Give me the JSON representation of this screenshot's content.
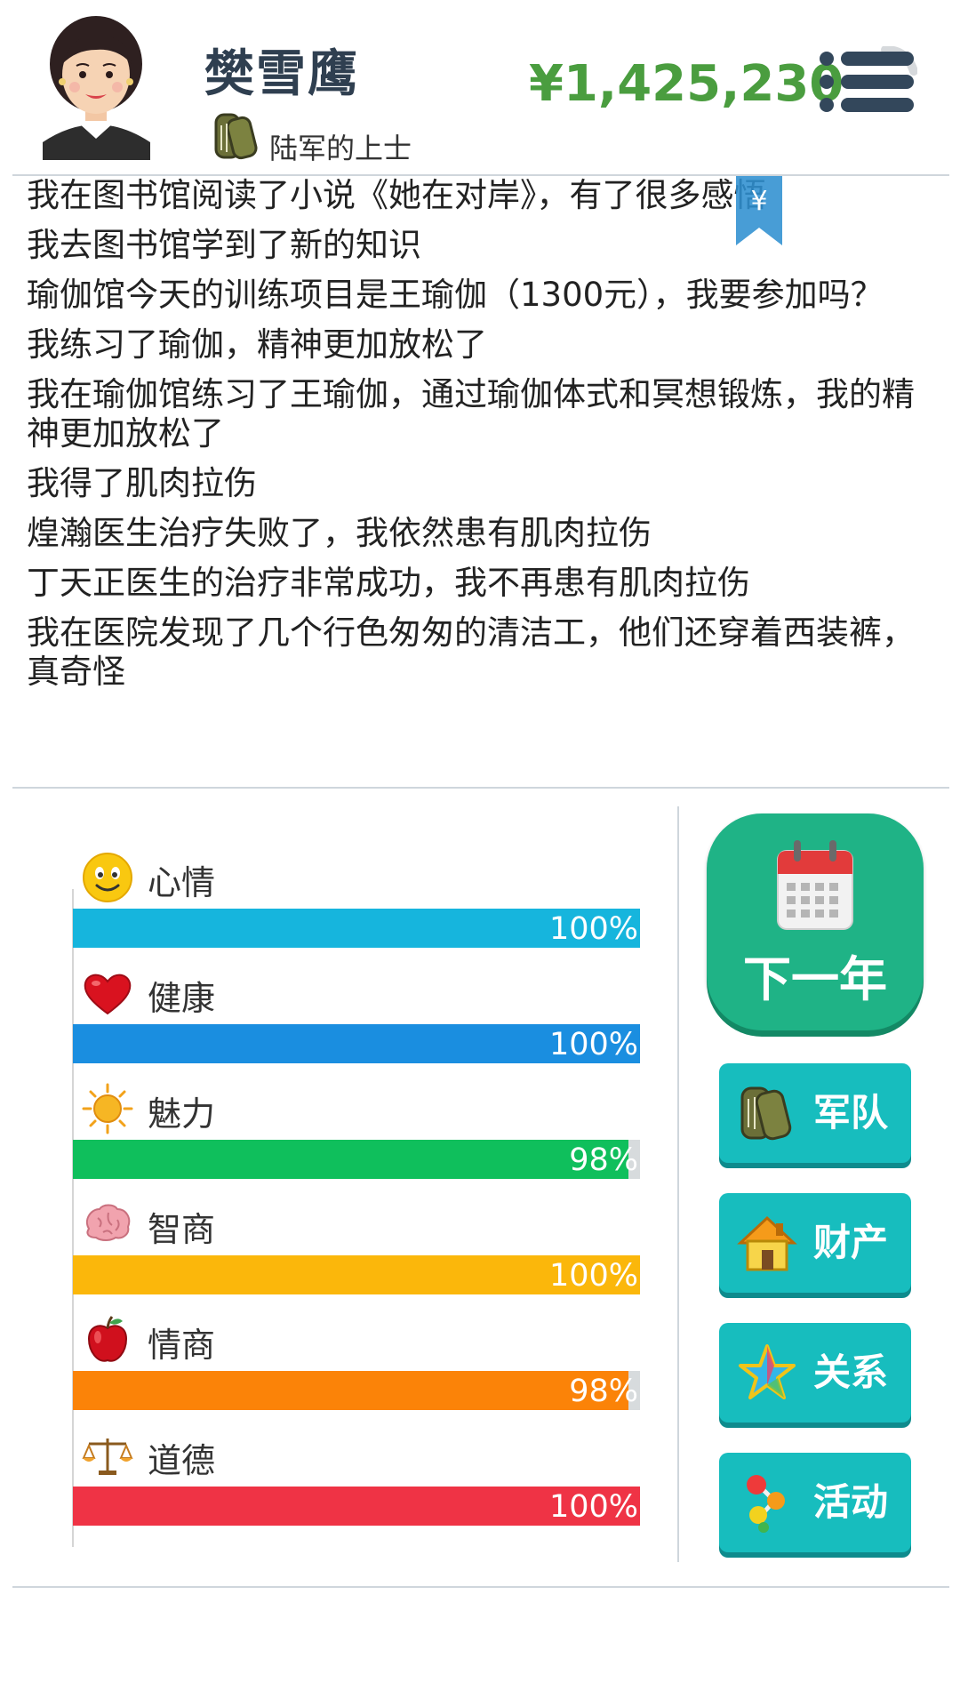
{
  "header": {
    "name": "樊雪鹰",
    "rank": "陆军的上士",
    "money": "¥1,425,230",
    "icons": {
      "avatar": "woman-avatar",
      "rank": "military-dog-tags-icon",
      "menu": "menu-icon",
      "bookmark": "yuan-bookmark-icon"
    },
    "bookmark_symbol": "¥"
  },
  "log": [
    "我在图书馆阅读了小说《她在对岸》，有了很多感悟",
    "我去图书馆学到了新的知识",
    "瑜伽馆今天的训练项目是王瑜伽（1300元），我要参加吗？",
    "我练习了瑜伽，精神更加放松了",
    "我在瑜伽馆练习了王瑜伽，通过瑜伽体式和冥想锻炼，我的精神更加放松了",
    "我得了肌肉拉伤",
    "煌瀚医生治疗失败了，我依然患有肌肉拉伤",
    "丁天正医生的治疗非常成功，我不再患有肌肉拉伤",
    "我在医院发现了几个行色匆匆的清洁工，他们还穿着西装裤，真奇怪"
  ],
  "stats": [
    {
      "name": "心情",
      "value": 100,
      "label": "100%",
      "color": "#16b5dd",
      "icon": "smiley-icon"
    },
    {
      "name": "健康",
      "value": 100,
      "label": "100%",
      "color": "#1a8ee0",
      "icon": "heart-icon"
    },
    {
      "name": "魅力",
      "value": 98,
      "label": "98%",
      "color": "#0fbf5c",
      "icon": "sun-icon"
    },
    {
      "name": "智商",
      "value": 100,
      "label": "100%",
      "color": "#fbb70b",
      "icon": "brain-icon"
    },
    {
      "name": "情商",
      "value": 98,
      "label": "98%",
      "color": "#fb8308",
      "icon": "apple-icon"
    },
    {
      "name": "道德",
      "value": 100,
      "label": "100%",
      "color": "#ef3345",
      "icon": "scales-icon"
    }
  ],
  "buttons": {
    "next_year": "下一年",
    "side": [
      {
        "label": "军队",
        "icon": "military-dog-tags-icon"
      },
      {
        "label": "财产",
        "icon": "house-icon"
      },
      {
        "label": "关系",
        "icon": "star-icon"
      },
      {
        "label": "活动",
        "icon": "activity-dots-icon"
      }
    ]
  },
  "colors": {
    "money": "#4a9d3f",
    "name": "#2f3f50",
    "primary_button": "#1fb386",
    "side_button": "#17bdbe"
  }
}
